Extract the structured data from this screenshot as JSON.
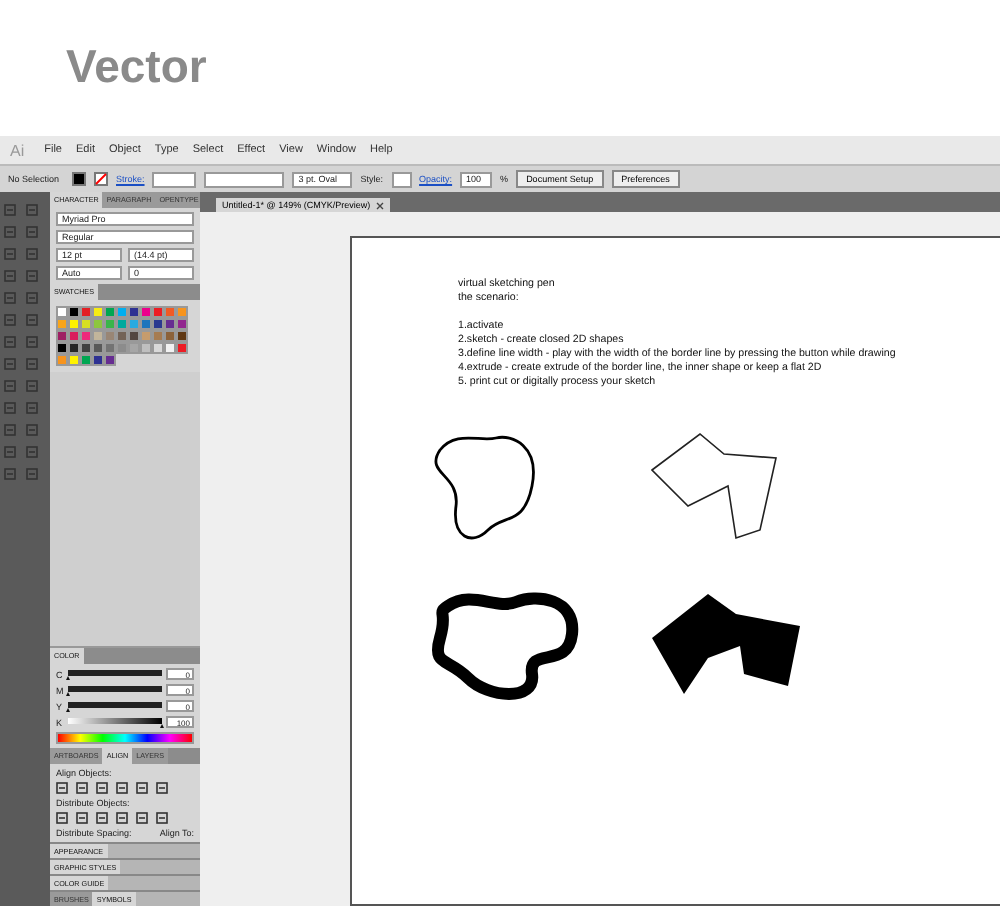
{
  "heading": "Vector",
  "app": {
    "logo": "Ai",
    "menu": [
      "File",
      "Edit",
      "Object",
      "Type",
      "Select",
      "Effect",
      "View",
      "Window",
      "Help"
    ],
    "control_bar": {
      "selection": "No Selection",
      "stroke_label": "Stroke:",
      "brush": "3 pt. Oval",
      "style_label": "Style:",
      "opacity_label": "Opacity:",
      "opacity": "100",
      "percent": "%",
      "buttons": [
        "Document Setup",
        "Preferences"
      ]
    },
    "document_tab": {
      "title": "Untitled-1* @ 149% (CMYK/Preview)"
    },
    "character_panel": {
      "tabs": [
        {
          "label": "CHARACTER",
          "selected": true
        },
        {
          "label": "PARAGRAPH",
          "selected": false
        },
        {
          "label": "OPENTYPE",
          "selected": false
        }
      ],
      "font": "Myriad Pro",
      "style": "Regular",
      "size": "12 pt",
      "leading": "(14.4 pt)",
      "kerning": "Auto",
      "tracking": "0"
    },
    "swatches_panel": {
      "tabs": [
        {
          "label": "SWATCHES",
          "selected": true
        }
      ],
      "swatches": [
        {
          "color": "#ffffff"
        },
        {
          "color": "#000000"
        },
        {
          "color": "#e31e24"
        },
        {
          "color": "#f7ec13"
        },
        {
          "color": "#00a650"
        },
        {
          "color": "#00aeef"
        },
        {
          "color": "#2e3192"
        },
        {
          "color": "#ec008c"
        },
        {
          "color": "#ed1c24"
        },
        {
          "color": "#f15a24"
        },
        {
          "color": "#f7941d"
        },
        {
          "color": "#f9a51a"
        },
        {
          "color": "#fff200"
        },
        {
          "color": "#d7df23"
        },
        {
          "color": "#8dc63f"
        },
        {
          "color": "#39b54a"
        },
        {
          "color": "#00a99d"
        },
        {
          "color": "#27aae1"
        },
        {
          "color": "#1c75bc"
        },
        {
          "color": "#2b3990"
        },
        {
          "color": "#662d91"
        },
        {
          "color": "#92278f"
        },
        {
          "color": "#9e1f63"
        },
        {
          "color": "#da1c5c"
        },
        {
          "color": "#ee2a7b"
        },
        {
          "color": "#c2b59b"
        },
        {
          "color": "#998675"
        },
        {
          "color": "#736357"
        },
        {
          "color": "#534741"
        },
        {
          "color": "#c69c6d"
        },
        {
          "color": "#a67c52"
        },
        {
          "color": "#8c6239"
        },
        {
          "color": "#603813"
        },
        {
          "color": "#000000"
        },
        {
          "color": "#262626"
        },
        {
          "color": "#404040"
        },
        {
          "color": "#595959"
        },
        {
          "color": "#737373"
        },
        {
          "color": "#8c8c8c"
        },
        {
          "color": "#a6a6a6"
        },
        {
          "color": "#bfbfbf"
        },
        {
          "color": "#d9d9d9"
        },
        {
          "color": "#f2f2f2"
        },
        {
          "color": "#ed1c24"
        },
        {
          "color": "#f7941d"
        },
        {
          "color": "#fff200"
        },
        {
          "color": "#00a651"
        },
        {
          "color": "#2e3192"
        },
        {
          "color": "#662d91"
        }
      ]
    },
    "color_panel": {
      "title": "COLOR",
      "channels": [
        {
          "name": "C",
          "level": 0,
          "reading": "0"
        },
        {
          "name": "M",
          "level": 0,
          "reading": "0"
        },
        {
          "name": "Y",
          "level": 0,
          "reading": "0"
        },
        {
          "name": "K",
          "level": 1,
          "reading": "100"
        }
      ]
    },
    "align_panel": {
      "tabs": [
        {
          "label": "ARTBOARDS",
          "selected": false
        },
        {
          "label": "ALIGN",
          "selected": true
        },
        {
          "label": "LAYERS",
          "selected": false
        }
      ],
      "align_objects": "Align Objects:",
      "distribute_objects": "Distribute Objects:",
      "distribute_spacing": "Distribute Spacing:",
      "align_to": "Align To:"
    },
    "collapsed_panels": [
      {
        "tabs": [
          {
            "label": "APPEARANCE",
            "selected": true
          }
        ]
      },
      {
        "tabs": [
          {
            "label": "GRAPHIC STYLES",
            "selected": true
          }
        ]
      },
      {
        "tabs": [
          {
            "label": "COLOR GUIDE",
            "selected": true
          }
        ]
      },
      {
        "tabs": [
          {
            "label": "BRUSHES",
            "selected": false
          },
          {
            "label": "SYMBOLS",
            "selected": true
          }
        ]
      }
    ],
    "artboard": {
      "title_lines": [
        "virtual sketching pen",
        "the scenario:"
      ],
      "steps": [
        "1.activate",
        "2.sketch - create closed 2D shapes",
        "3.define line width - play with the width of the border line by pressing the button while drawing",
        "4.extrude - create extrude of the border line, the inner shape or keep a flat 2D",
        "5. print cut or digitally process your sketch"
      ],
      "shapes": [
        {
          "kind": "outline"
        },
        {
          "kind": "polygon"
        },
        {
          "kind": "thick"
        },
        {
          "kind": "filled"
        }
      ]
    }
  }
}
